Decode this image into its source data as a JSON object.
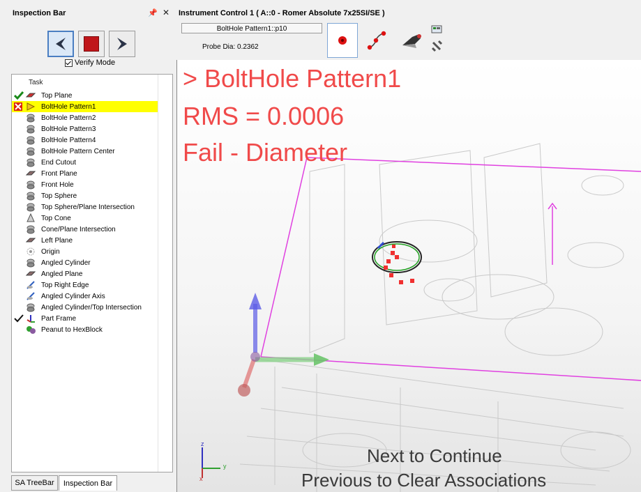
{
  "left_panel": {
    "title": "Inspection Bar",
    "pin_icon": "pin-icon",
    "close_icon": "close-icon",
    "verify_mode_label": "Verify Mode",
    "verify_mode_checked": true,
    "task_header": "Task",
    "tasks": [
      {
        "label": "Top Plane",
        "status": "check-x"
      },
      {
        "label": "BoltHole Pattern1",
        "status": "x-arrow",
        "selected": true
      },
      {
        "label": "BoltHole Pattern2",
        "status": ""
      },
      {
        "label": "BoltHole Pattern3",
        "status": ""
      },
      {
        "label": "BoltHole Pattern4",
        "status": ""
      },
      {
        "label": "BoltHole Pattern Center",
        "status": ""
      },
      {
        "label": "End Cutout",
        "status": ""
      },
      {
        "label": "Front Plane",
        "status": ""
      },
      {
        "label": "Front Hole",
        "status": ""
      },
      {
        "label": "Top Sphere",
        "status": ""
      },
      {
        "label": "Top Sphere/Plane Intersection",
        "status": ""
      },
      {
        "label": "Top Cone",
        "status": ""
      },
      {
        "label": "Cone/Plane Intersection",
        "status": ""
      },
      {
        "label": "Left Plane",
        "status": ""
      },
      {
        "label": "Origin",
        "status": ""
      },
      {
        "label": "Angled Cylinder",
        "status": ""
      },
      {
        "label": "Angled Plane",
        "status": ""
      },
      {
        "label": "Top Right Edge",
        "status": ""
      },
      {
        "label": "Angled Cylinder Axis",
        "status": ""
      },
      {
        "label": "Angled Cylinder/Top Intersection",
        "status": ""
      },
      {
        "label": "Part Frame",
        "status": "check"
      },
      {
        "label": "Peanut to HexBlock",
        "status": ""
      }
    ],
    "tabs": [
      "SA TreeBar",
      "Inspection Bar"
    ]
  },
  "instrument": {
    "title": "Instrument Control 1 ( A::0 - Romer Absolute 7x25SI/SE )",
    "object_name": "BoltHole Pattern1::p10",
    "probe_dia": "Probe Dia: 0.2362"
  },
  "view": {
    "line1": "> BoltHole Pattern1",
    "line2": "RMS = 0.0006",
    "line3": "Fail - Diameter",
    "hint1": "Next to Continue",
    "hint2": "Previous to Clear Associations",
    "axis_x": "y",
    "axis_z": "z",
    "axis_x2": "x"
  },
  "colors": {
    "status_text": "#f04a4a",
    "selected_row": "#ffff00",
    "outline": "#e040e0"
  }
}
